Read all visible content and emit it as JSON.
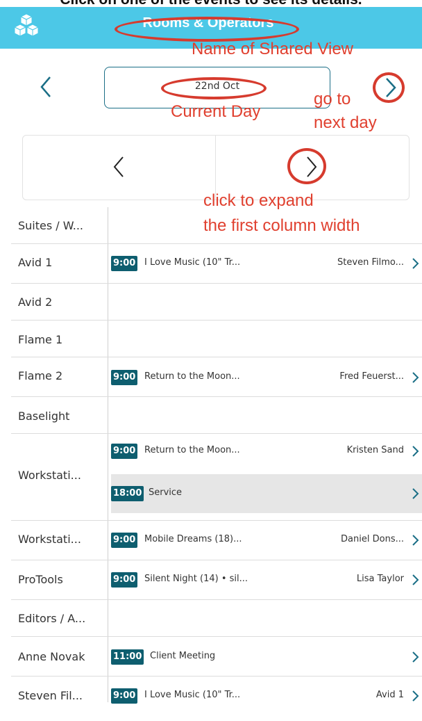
{
  "caption": "Click on one of the events to see its details.",
  "header": {
    "title": "Rooms & Operators",
    "bg_color": "#4cc8e7"
  },
  "date_nav": {
    "current_day": "22nd Oct"
  },
  "annotations": {
    "shared_view": "Name of Shared View",
    "current_day": "Current Day",
    "next_day_1": "go to",
    "next_day_2": "next day",
    "expand_1": "click to expand",
    "expand_2": "the first column width",
    "color": "#e0402f"
  },
  "rows": [
    {
      "label": "Suites / W...",
      "events": []
    },
    {
      "label": "Avid 1",
      "events": [
        {
          "time": "9:00",
          "title": "I Love Music (10\" Tr...",
          "assignee": "Steven Filmo..."
        }
      ]
    },
    {
      "label": "Avid 2",
      "events": []
    },
    {
      "label": "Flame 1",
      "events": []
    },
    {
      "label": "Flame 2",
      "events": [
        {
          "time": "9:00",
          "title": "Return to the Moon...",
          "assignee": "Fred Feuerst..."
        }
      ]
    },
    {
      "label": "Baselight",
      "events": []
    },
    {
      "label": "Workstati...",
      "events": [
        {
          "time": "9:00",
          "title": "Return to the Moon...",
          "assignee": "Kristen Sand"
        },
        {
          "time": "18:00",
          "title": "Service",
          "assignee": ""
        }
      ]
    },
    {
      "label": "Workstati...",
      "events": [
        {
          "time": "9:00",
          "title": "Mobile Dreams (18)...",
          "assignee": "Daniel Dons..."
        }
      ]
    },
    {
      "label": "ProTools",
      "events": [
        {
          "time": "9:00",
          "title": "Silent Night (14) • sil...",
          "assignee": "Lisa Taylor"
        }
      ]
    },
    {
      "label": "Editors / A...",
      "events": []
    },
    {
      "label": "Anne Novak",
      "events": [
        {
          "time": "11:00",
          "title": "Client Meeting",
          "assignee": ""
        }
      ]
    },
    {
      "label": "Steven Fil...",
      "events": [
        {
          "time": "9:00",
          "title": "I Love Music (10\" Tr...",
          "assignee": "Avid 1"
        }
      ]
    }
  ]
}
